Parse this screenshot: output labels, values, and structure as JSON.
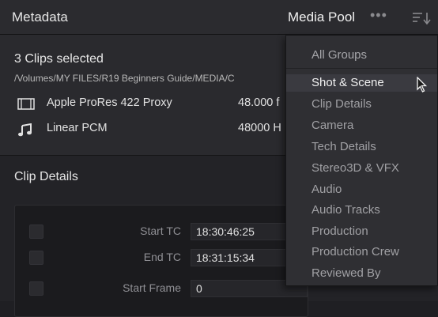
{
  "header": {
    "title": "Metadata",
    "media_pool": "Media Pool",
    "more": "•••"
  },
  "info": {
    "selection": "3 Clips selected",
    "path": "/Volumes/MY FILES/R19 Beginners Guide/MEDIA/C",
    "video": {
      "label": "Apple ProRes 422 Proxy",
      "value": "48.000 f"
    },
    "audio": {
      "label": "Linear PCM",
      "value": "48000 H"
    }
  },
  "section": {
    "title": "Clip Details",
    "fields": [
      {
        "label": "Start TC",
        "value": "18:30:46:25"
      },
      {
        "label": "End TC",
        "value": "18:31:15:34"
      },
      {
        "label": "Start Frame",
        "value": "0"
      }
    ]
  },
  "menu": {
    "header": "All Groups",
    "items": [
      "Shot & Scene",
      "Clip Details",
      "Camera",
      "Tech Details",
      "Stereo3D & VFX",
      "Audio",
      "Audio Tracks",
      "Production",
      "Production Crew",
      "Reviewed By"
    ],
    "highlighted": "Shot & Scene"
  }
}
